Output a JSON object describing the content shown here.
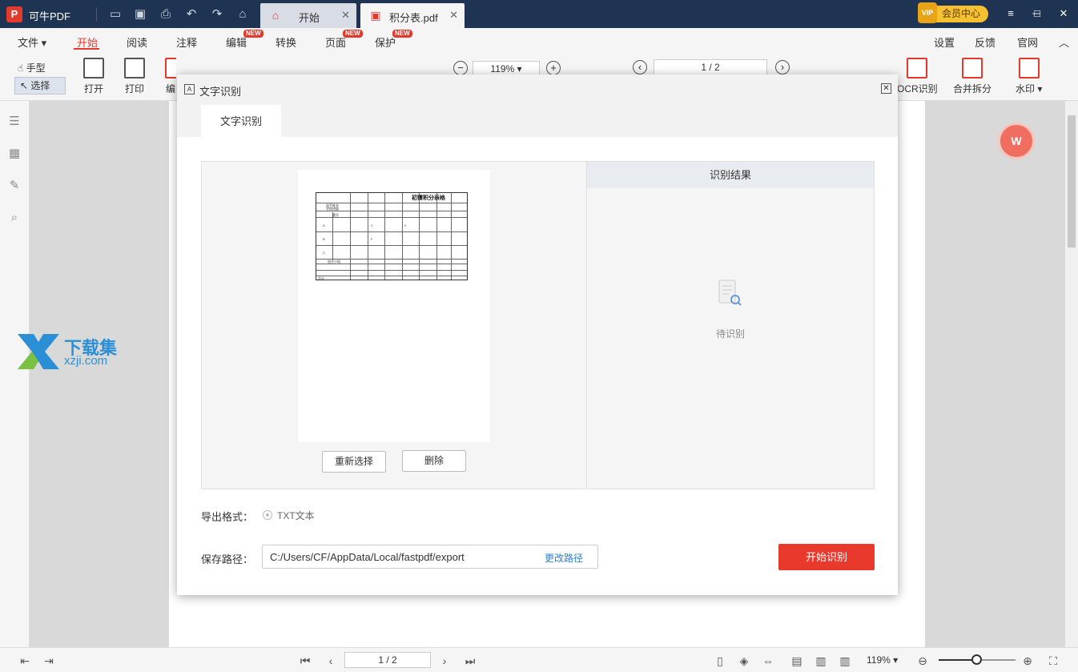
{
  "app": {
    "logo": "P",
    "name": "可牛PDF"
  },
  "tabs": [
    {
      "label": "开始",
      "icon": "home-icon"
    },
    {
      "label": "积分表.pdf",
      "icon": "pdf-file-icon"
    }
  ],
  "vip": {
    "badge": "VIP",
    "label": "会员中心"
  },
  "menu": {
    "items": [
      "文件",
      "开始",
      "阅读",
      "注释",
      "编辑",
      "转换",
      "页面",
      "保护"
    ],
    "new_badge": "NEW",
    "right": [
      "设置",
      "反馈",
      "官网"
    ]
  },
  "toolbar": {
    "hand": "手型",
    "select": "选择",
    "open": "打开",
    "print": "打印",
    "edit_partial": "编",
    "zoom": "119%",
    "page": "1 / 2",
    "ocr": "OCR识别",
    "merge": "合并拆分",
    "watermark": "水印"
  },
  "watermark_logo": {
    "cn": "下载集",
    "en": "xzji.com"
  },
  "dialog": {
    "title": "文字识别",
    "tab": "文字识别",
    "preview_doc": {
      "title": "初賽积分表格",
      "cells": [
        "选手姓名",
        "学校班级",
        "题号",
        "A",
        "B",
        "C",
        "D",
        "E",
        "F",
        "加分小组",
        "总计"
      ]
    },
    "reselect_btn": "重新选择",
    "delete_btn": "删除",
    "result_header": "识别结果",
    "result_status": "待识别",
    "export_format_label": "导出格式：",
    "export_format_option": "TXT文本",
    "save_path_label": "保存路径：",
    "save_path": "C:/Users/CF/AppData/Local/fastpdf/export",
    "change_path": "更改路径",
    "start_btn": "开始识别"
  },
  "statusbar": {
    "page": "1 / 2",
    "zoom": "119%",
    "zoom_fraction": 0.45
  }
}
